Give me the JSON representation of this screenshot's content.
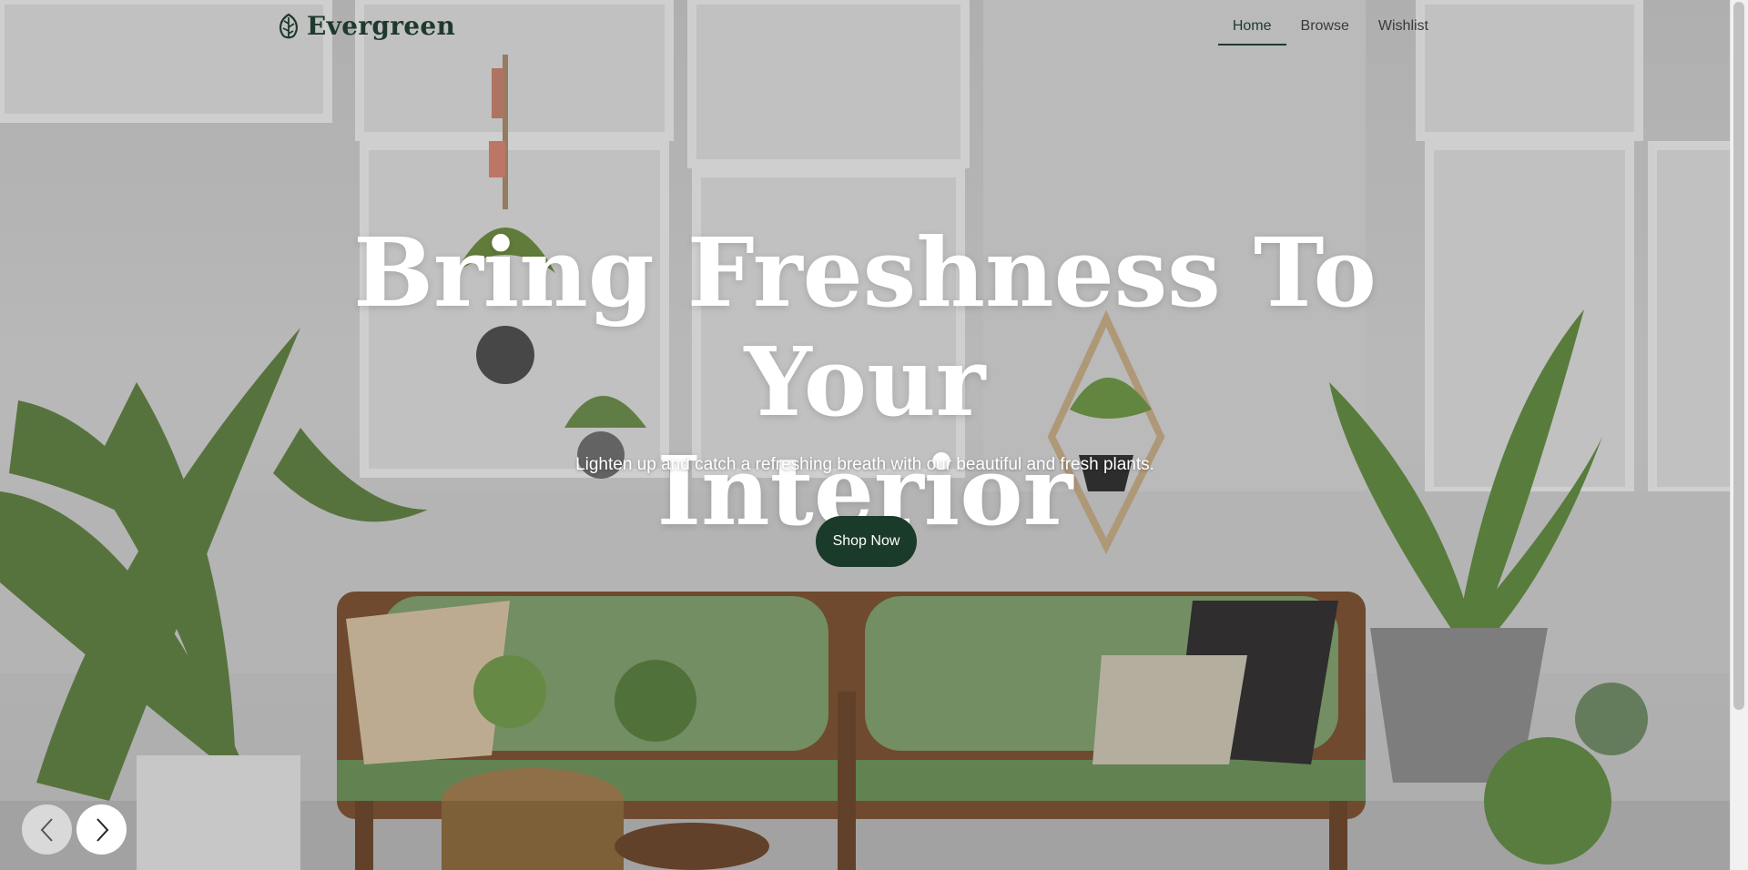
{
  "brand": {
    "name": "Evergreen",
    "icon": "leaf-icon"
  },
  "nav": {
    "items": [
      {
        "label": "Home",
        "active": true
      },
      {
        "label": "Browse",
        "active": false
      },
      {
        "label": "Wishlist",
        "active": false
      }
    ]
  },
  "hero": {
    "headline_line1": "Bring Freshness To Your",
    "headline_line2": "Interior",
    "subheadline": "Lighten up and catch a refreshing breath with our beautiful and fresh plants.",
    "cta_label": "Shop Now"
  },
  "slider": {
    "prev_icon": "chevron-left-icon",
    "next_icon": "chevron-right-icon"
  },
  "colors": {
    "brand_dark_green": "#1a3a2a",
    "text_light": "#ffffff"
  }
}
